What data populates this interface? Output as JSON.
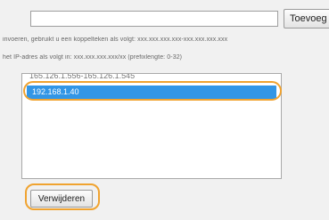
{
  "form": {
    "address_input": {
      "value": "",
      "placeholder": ""
    },
    "add_button_label": "Toevoeg"
  },
  "hints": {
    "ipv6_hint": "invoeren, gebruikt u een koppelteken als volgt: xxx.xxx.xxx.xxx-xxx.xxx.xxx.xxx",
    "prefix_hint": "het IP-adres als volgt in: xxx.xxx.xxx.xxx/xx (prefixlengte: 0-32)"
  },
  "address_list": {
    "items": [
      {
        "label": "165.126.1.556-165.126.1.545",
        "selected": false
      },
      {
        "label": "192.168.1.40",
        "selected": true
      }
    ]
  },
  "remove_button_label": "Verwijderen",
  "colors": {
    "selection": "#3296e6",
    "highlight_ring": "#f0a330"
  }
}
